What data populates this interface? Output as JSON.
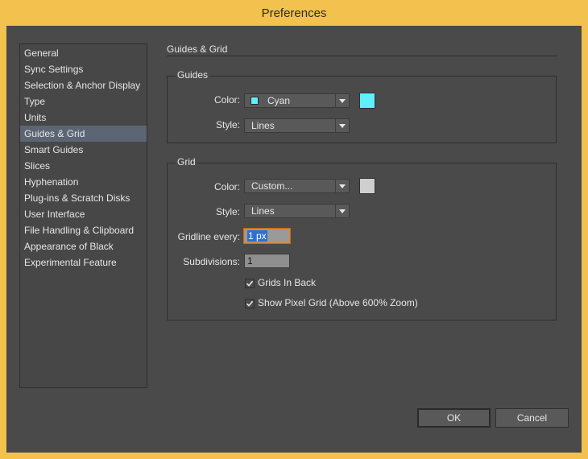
{
  "window": {
    "title": "Preferences"
  },
  "sidebar": {
    "items": [
      {
        "label": "General"
      },
      {
        "label": "Sync Settings"
      },
      {
        "label": "Selection & Anchor Display"
      },
      {
        "label": "Type"
      },
      {
        "label": "Units"
      },
      {
        "label": "Guides & Grid"
      },
      {
        "label": "Smart Guides"
      },
      {
        "label": "Slices"
      },
      {
        "label": "Hyphenation"
      },
      {
        "label": "Plug-ins & Scratch Disks"
      },
      {
        "label": "User Interface"
      },
      {
        "label": "File Handling & Clipboard"
      },
      {
        "label": "Appearance of Black"
      },
      {
        "label": "Experimental Feature"
      }
    ],
    "selected": "Guides & Grid"
  },
  "section": {
    "title": "Guides & Grid"
  },
  "guides": {
    "title": "Guides",
    "color_label": "Color:",
    "color_value": "Cyan",
    "color_hex": "#5ff0ff",
    "style_label": "Style:",
    "style_value": "Lines"
  },
  "grid": {
    "title": "Grid",
    "color_label": "Color:",
    "color_value": "Custom...",
    "color_hex": "#cfcfcf",
    "style_label": "Style:",
    "style_value": "Lines",
    "gridline_label": "Gridline every:",
    "gridline_value": "1 px",
    "subdivisions_label": "Subdivisions:",
    "subdivisions_value": "1",
    "grids_in_back_label": "Grids In Back",
    "grids_in_back_checked": true,
    "pixel_grid_label": "Show Pixel Grid (Above 600% Zoom)",
    "pixel_grid_checked": true
  },
  "buttons": {
    "ok": "OK",
    "cancel": "Cancel"
  },
  "colors": {
    "accent_selected": "#5c6573",
    "window_frame": "#f3c14d",
    "panel_bg": "#4a4a4a"
  }
}
